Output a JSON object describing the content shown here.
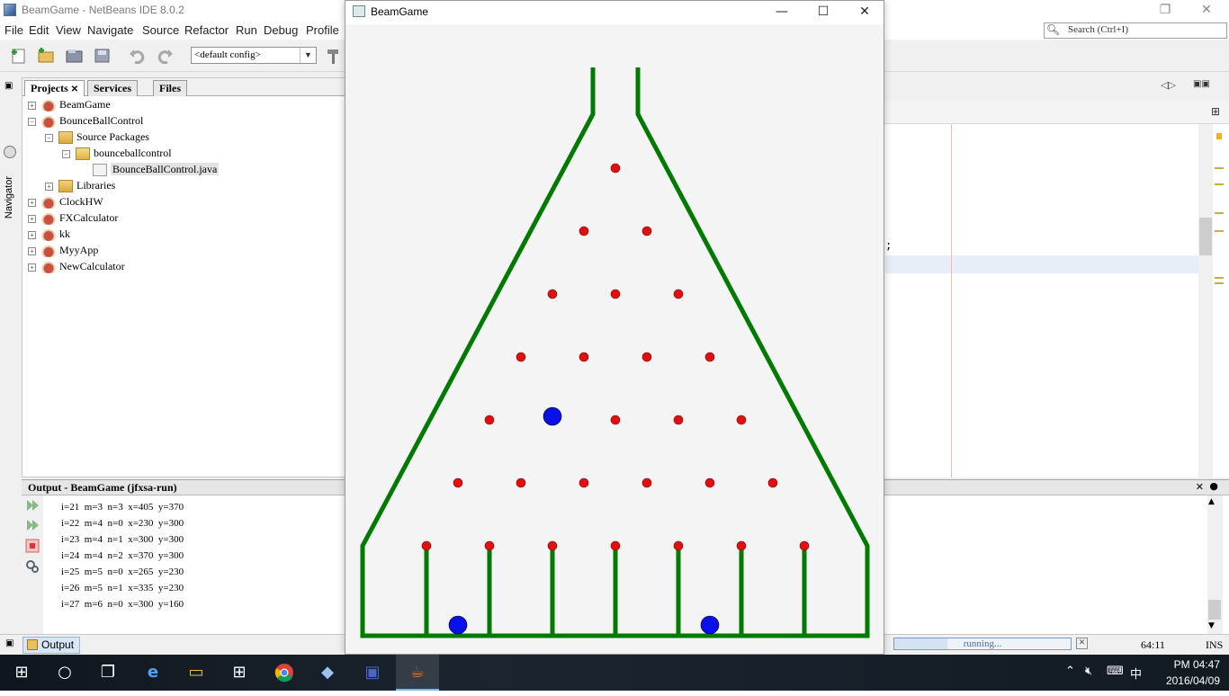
{
  "ide": {
    "title": "BeamGame - NetBeans IDE 8.0.2",
    "menu": [
      "File",
      "Edit",
      "View",
      "Navigate",
      "Source",
      "Refactor",
      "Run",
      "Debug",
      "Profile"
    ],
    "search_placeholder": "Search (Ctrl+I)",
    "config_value": "<default config>",
    "navigator_label": "Navigator",
    "project_tabs": [
      {
        "label": "Projects",
        "active": true,
        "closable": true
      },
      {
        "label": "Services",
        "active": false
      },
      {
        "label": "Files",
        "active": false
      }
    ],
    "tree": [
      {
        "label": "BeamGame",
        "level": 0,
        "kind": "project",
        "expander": "+"
      },
      {
        "label": "BounceBallControl",
        "level": 0,
        "kind": "project",
        "expander": "-"
      },
      {
        "label": "Source Packages",
        "level": 1,
        "kind": "folder",
        "expander": "-"
      },
      {
        "label": "bounceballcontrol",
        "level": 2,
        "kind": "package",
        "expander": "-"
      },
      {
        "label": "BounceBallControl.java",
        "level": 3,
        "kind": "java",
        "selected": true
      },
      {
        "label": "Libraries",
        "level": 1,
        "kind": "folder",
        "expander": "+"
      },
      {
        "label": "ClockHW",
        "level": 0,
        "kind": "project",
        "expander": "+"
      },
      {
        "label": "FXCalculator",
        "level": 0,
        "kind": "project",
        "expander": "+"
      },
      {
        "label": "kk",
        "level": 0,
        "kind": "project",
        "expander": "+"
      },
      {
        "label": "MyyApp",
        "level": 0,
        "kind": "project",
        "expander": "+"
      },
      {
        "label": "NewCalculator",
        "level": 0,
        "kind": "project",
        "expander": "+"
      }
    ],
    "editor_fragment": ";",
    "output": {
      "title": "Output - BeamGame (jfxsa-run)",
      "lines": [
        "i=21  m=3  n=3  x=405  y=370",
        "i=22  m=4  n=0  x=230  y=300",
        "i=23  m=4  n=1  x=300  y=300",
        "i=24  m=4  n=2  x=370  y=300",
        "i=25  m=5  n=0  x=265  y=230",
        "i=26  m=5  n=1  x=335  y=230",
        "i=27  m=6  n=0  x=300  y=160"
      ]
    },
    "status": {
      "output_tab": "Output",
      "progress_text": "running...",
      "progress_fraction": 0.3,
      "caret": "64:11",
      "mode": "INS"
    }
  },
  "game": {
    "title": "BeamGame",
    "colors": {
      "wall": "#007a00",
      "peg": "#e01010",
      "ball": "#0a10e8",
      "background": "#f4f4f4"
    },
    "balls": [
      {
        "location": "peg row 5, between first and second peg"
      },
      {
        "location": "bin 2"
      },
      {
        "location": "bin 6"
      }
    ]
  },
  "taskbar": {
    "items": [
      {
        "name": "start-button",
        "glyph": "⊞"
      },
      {
        "name": "search-button",
        "glyph": "⚲"
      },
      {
        "name": "task-view-button",
        "glyph": "❐"
      },
      {
        "name": "edge-app",
        "glyph": "e"
      },
      {
        "name": "file-explorer-app",
        "glyph": "▭"
      },
      {
        "name": "store-app",
        "glyph": "⊞"
      },
      {
        "name": "chrome-app",
        "glyph": "◉"
      },
      {
        "name": "virtualbox-app",
        "glyph": "◆"
      },
      {
        "name": "save-app",
        "glyph": "▣"
      },
      {
        "name": "java-app",
        "glyph": "☕",
        "active": true
      }
    ],
    "time": "PM 04:47",
    "date": "2016/04/09",
    "ime": "中"
  }
}
